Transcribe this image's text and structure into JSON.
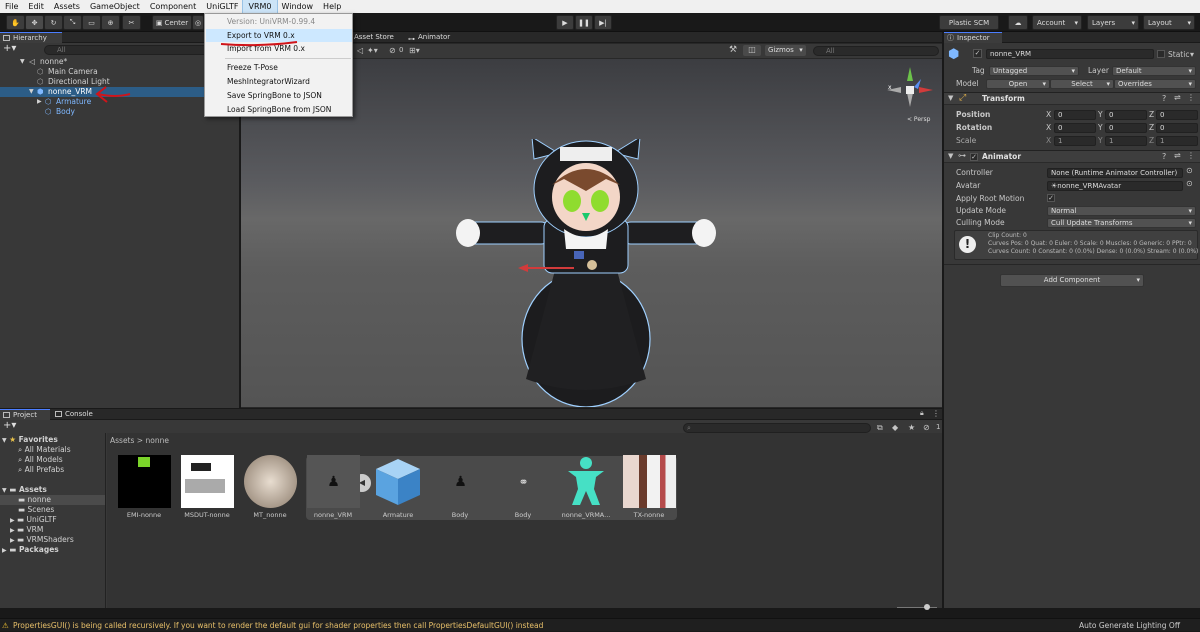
{
  "menubar": {
    "items": [
      "File",
      "Edit",
      "Assets",
      "GameObject",
      "Component",
      "UniGLTF",
      "VRM0",
      "Window",
      "Help"
    ],
    "active": "VRM0"
  },
  "toolbar": {
    "pivot_label": "Center",
    "plastic_label": "Plastic SCM",
    "account_label": "Account",
    "layers_label": "Layers",
    "layout_label": "Layout"
  },
  "vrm_menu": {
    "items": [
      {
        "label": "Version: UniVRM-0.99.4",
        "disabled": true
      },
      {
        "label": "Export to VRM 0.x",
        "highlighted": true
      },
      {
        "label": "Import from VRM 0.x"
      },
      {
        "label": "Freeze T-Pose"
      },
      {
        "label": "MeshIntegratorWizard"
      },
      {
        "label": "Save SpringBone to JSON"
      },
      {
        "label": "Load SpringBone from JSON"
      }
    ]
  },
  "hierarchy": {
    "tab": "Hierarchy",
    "search_placeholder": "All",
    "rows": [
      {
        "label": "nonne*"
      },
      {
        "label": "Main Camera"
      },
      {
        "label": "Directional Light"
      },
      {
        "label": "nonne_VRM"
      },
      {
        "label": "Armature"
      },
      {
        "label": "Body"
      }
    ]
  },
  "scene": {
    "tabs": [
      "Asset Store",
      "Animator"
    ],
    "gizmos_label": "Gizmos",
    "search_placeholder": "All",
    "hidden_count": "0"
  },
  "inspector": {
    "tab": "Inspector",
    "object_name": "nonne_VRM",
    "static_label": "Static",
    "tag_label": "Tag",
    "tag_value": "Untagged",
    "layer_label": "Layer",
    "layer_value": "Default",
    "model_label": "Model",
    "open_label": "Open",
    "select_label": "Select",
    "overrides_label": "Overrides",
    "transform": {
      "title": "Transform",
      "position_label": "Position",
      "rotation_label": "Rotation",
      "scale_label": "Scale",
      "position": [
        "0",
        "0",
        "0"
      ],
      "rotation": [
        "0",
        "0",
        "0"
      ],
      "scale": [
        "1",
        "1",
        "1"
      ]
    },
    "animator": {
      "title": "Animator",
      "controller_label": "Controller",
      "controller_value": "None (Runtime Animator Controller)",
      "avatar_label": "Avatar",
      "avatar_value": "nonne_VRMAvatar",
      "root_motion_label": "Apply Root Motion",
      "update_mode_label": "Update Mode",
      "update_mode_value": "Normal",
      "culling_label": "Culling Mode",
      "culling_value": "Cull Update Transforms",
      "info_line1": "Clip Count: 0",
      "info_line2": "Curves Pos: 0 Quat: 0 Euler: 0 Scale: 0 Muscles: 0 Generic: 0 PPtr: 0",
      "info_line3": "Curves Count: 0 Constant: 0 (0.0%) Dense: 0 (0.0%) Stream: 0 (0.0%)"
    },
    "add_component_label": "Add Component"
  },
  "project": {
    "tabs": [
      "Project",
      "Console"
    ],
    "hidden_count": "1",
    "breadcrumb_root": "Assets",
    "breadcrumb_current": "nonne",
    "favorites_label": "Favorites",
    "favorites": [
      "All Materials",
      "All Models",
      "All Prefabs"
    ],
    "assets_label": "Assets",
    "folders": [
      "nonne",
      "Scenes",
      "UniGLTF",
      "VRM",
      "VRMShaders"
    ],
    "packages_label": "Packages",
    "assets": [
      "EMI-nonne",
      "MSDUT-nonne",
      "MT_nonne",
      "nonne_VRM",
      "Armature",
      "Body",
      "Body",
      "nonne_VRMA...",
      "TX-nonne"
    ]
  },
  "status": {
    "message": "PropertiesGUI() is being called recursively. If you want to render the default gui for shader properties then call PropertiesDefaultGUI() instead",
    "right_label": "Auto Generate Lighting Off"
  },
  "colors": {
    "selection": "#2c5d87",
    "annotation": "#d0141a",
    "menu_highlight": "#cde8ff"
  }
}
